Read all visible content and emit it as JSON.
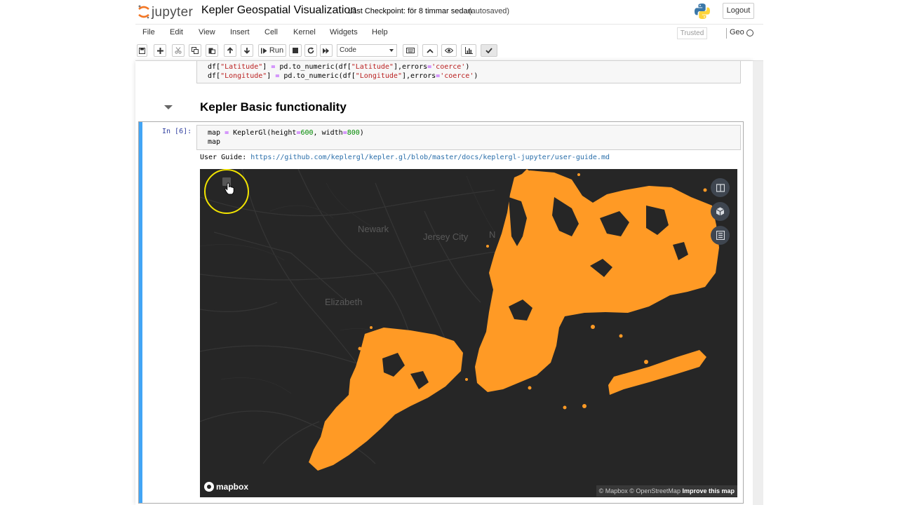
{
  "header": {
    "logo_text": "jupyter",
    "notebook_title": "Kepler Geospatial Visualization",
    "checkpoint": "Last Checkpoint: för 8 timmar sedan",
    "autosaved": "(autosaved)",
    "logout_label": "Logout"
  },
  "menubar": {
    "items": [
      "File",
      "Edit",
      "View",
      "Insert",
      "Cell",
      "Kernel",
      "Widgets",
      "Help"
    ],
    "trusted": "Trusted",
    "kernel_name": "Geo"
  },
  "toolbar": {
    "run_label": "Run",
    "cell_type": "Code"
  },
  "prev_cell": {
    "line1_a": "df[",
    "line1_b": "\"Latitude\"",
    "line1_c": "] ",
    "line1_d": "=",
    "line1_e": " pd.to_numeric(df[",
    "line1_f": "\"Latitude\"",
    "line1_g": "],errors",
    "line1_h": "=",
    "line1_i": "'coerce'",
    "line1_j": ")",
    "line2_a": "df[",
    "line2_b": "\"Longitude\"",
    "line2_c": "] ",
    "line2_d": "=",
    "line2_e": " pd.to_numeric(df[",
    "line2_f": "\"Longitude\"",
    "line2_g": "],errors",
    "line2_h": "=",
    "line2_i": "'coerce'",
    "line2_j": ")"
  },
  "section": {
    "heading": "Kepler Basic functionality"
  },
  "cell": {
    "prompt": "In [6]:",
    "code_a": "map ",
    "code_b": "=",
    "code_c": " KeplerGl(height",
    "code_d": "=",
    "code_e": "600",
    "code_f": ", width",
    "code_g": "=",
    "code_h": "800",
    "code_i": ")",
    "code_line2": "map",
    "guide_label": "User Guide: ",
    "guide_link": "https://github.com/keplergl/kepler.gl/blob/master/docs/keplergl-jupyter/user-guide.md"
  },
  "map": {
    "places": [
      "Newark",
      "Jersey City",
      "Elizabeth",
      "N"
    ],
    "mapbox_logo": "mapbox",
    "attribution": "© Mapbox © OpenStreetMap",
    "improve": "Improve this map",
    "point_color": "#ff9a25",
    "background": "#262626",
    "controls": [
      "split-map-icon",
      "3d-view-icon",
      "layer-legend-icon"
    ]
  }
}
